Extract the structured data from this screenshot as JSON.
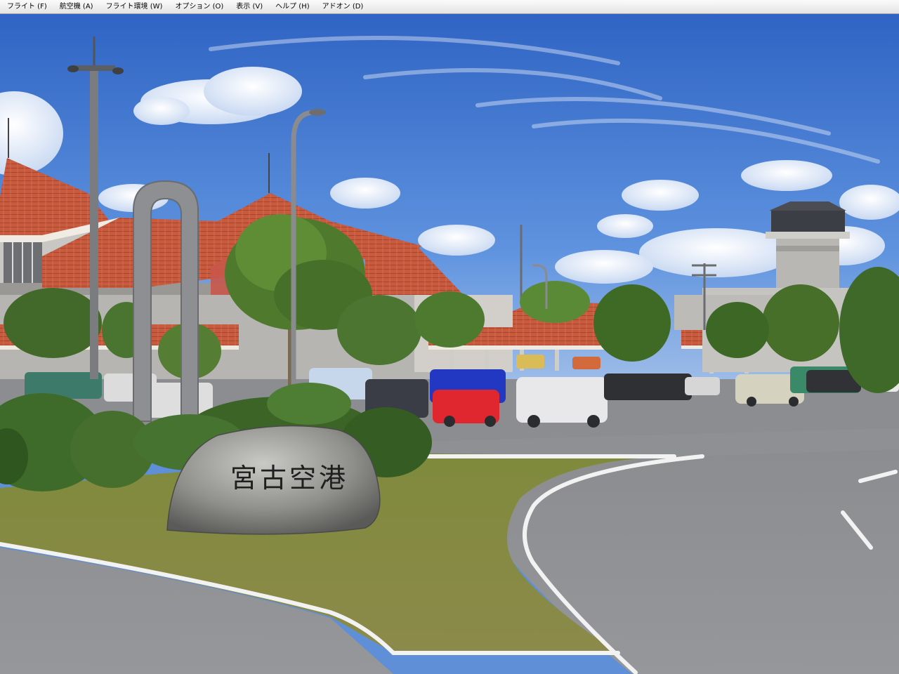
{
  "menubar": {
    "items": [
      {
        "label": "フライト (F)"
      },
      {
        "label": "航空機 (A)"
      },
      {
        "label": "フライト環境 (W)"
      },
      {
        "label": "オプション (O)"
      },
      {
        "label": "表示 (V)"
      },
      {
        "label": "ヘルプ (H)"
      },
      {
        "label": "アドオン (D)"
      }
    ]
  },
  "scene": {
    "monument_text": "宮古空港",
    "colors": {
      "sky_top": "#2f64c4",
      "sky_bottom": "#8fb3e6",
      "roof": "#c8563c",
      "grass": "#8a8a44",
      "road": "#8e8f92",
      "foliage": "#4f7a2e"
    }
  }
}
